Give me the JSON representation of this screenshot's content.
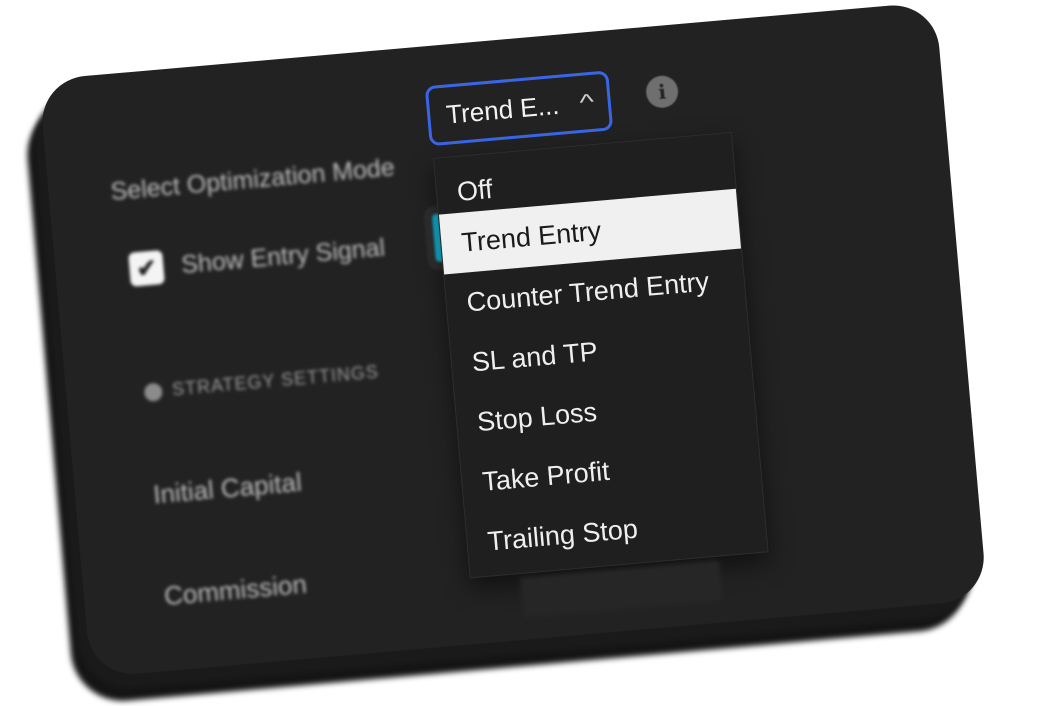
{
  "settings": {
    "optimization_mode_label": "Select Optimization Mode",
    "show_entry_signal_label": "Show Entry Signal",
    "show_entry_signal_checked": true,
    "entry_signal_color": "#12b5d6",
    "section_title": "STRATEGY SETTINGS",
    "initial_capital_label": "Initial Capital",
    "commission_label": "Commission"
  },
  "dropdown": {
    "current_value": "Trend E...",
    "options": [
      "Off",
      "Trend Entry",
      "Counter Trend Entry",
      "SL and TP",
      "Stop Loss",
      "Take Profit",
      "Trailing Stop"
    ],
    "selected_index": 1
  },
  "colors": {
    "accent_border": "#3a66e6",
    "panel_bg": "#222222",
    "selected_bg": "#f0f0f0"
  },
  "icons": {
    "info": "info-icon",
    "chevron": "chevron-up-icon",
    "check": "checkmark-icon"
  }
}
